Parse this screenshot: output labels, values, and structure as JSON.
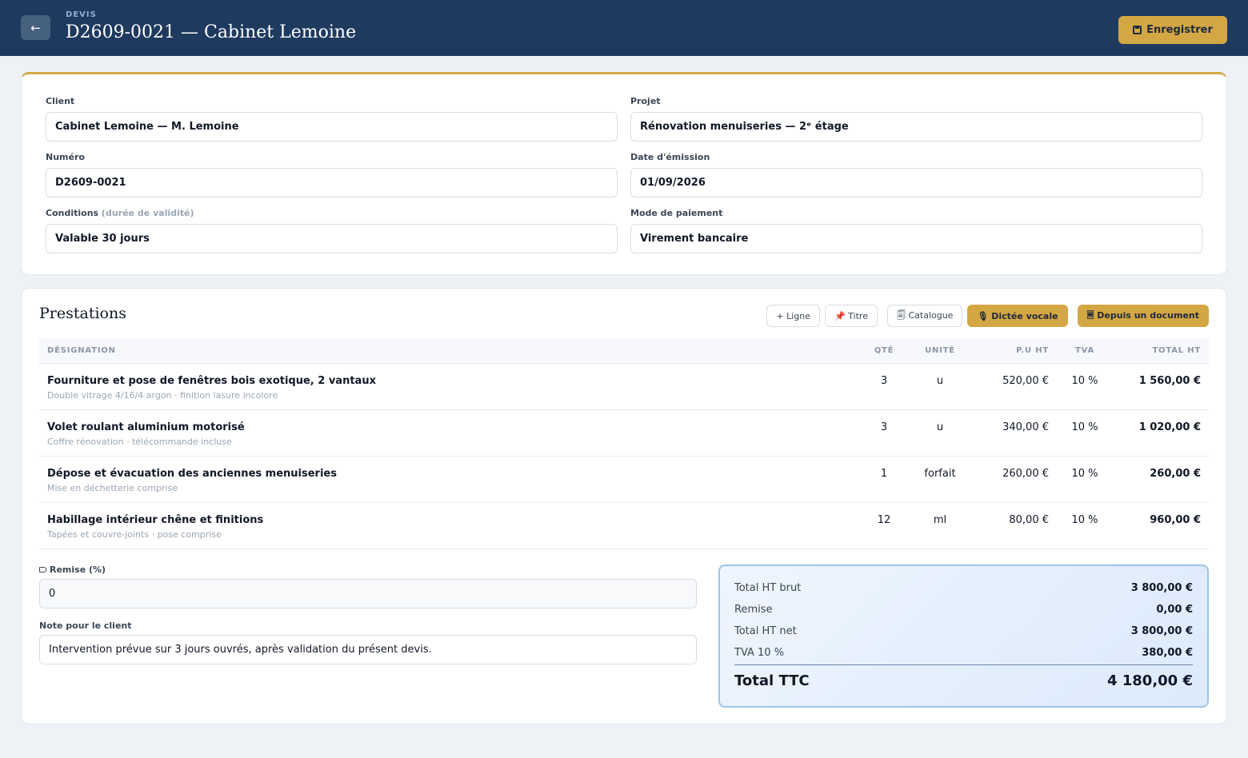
{
  "header": {
    "back_icon": "←",
    "kicker": "DEVIS",
    "title": "D2609-0021 — Cabinet Lemoine",
    "save_label": "Enregistrer",
    "save_icon": "floppy-disk"
  },
  "info": {
    "client_label": "Client",
    "client_value": "Cabinet Lemoine — M. Lemoine",
    "project_label": "Projet",
    "project_value": "Rénovation menuiseries — 2ᵉ étage",
    "number_label": "Numéro",
    "number_value": "D2609-0021",
    "date_label": "Date d'émission",
    "date_value": "01/09/2026",
    "conditions_label": "Conditions",
    "conditions_hint": "(durée de validité)",
    "conditions_value": "Valable 30 jours",
    "payment_label": "Mode de paiement",
    "payment_value": "Virement bancaire"
  },
  "items": {
    "title": "Prestations",
    "toolbar": {
      "add_line": "+ Ligne",
      "add_title": "📌 Titre",
      "catalogue": "🗐 Catalogue",
      "dictation": "🎙 Dictée vocale",
      "from_document": "🗏 Depuis un document"
    },
    "columns": {
      "designation": "DÉSIGNATION",
      "qty": "QTÉ",
      "unit": "UNITÉ",
      "unit_price": "P.U HT",
      "vat": "TVA",
      "total": "TOTAL HT"
    },
    "rows": [
      {
        "title": "Fourniture et pose de fenêtres bois exotique, 2 vantaux",
        "sub": "Double vitrage 4/16/4 argon · finition lasure incolore",
        "qty": "3",
        "unit": "u",
        "price": "520,00 €",
        "vat": "10 %",
        "total": "1 560,00 €"
      },
      {
        "title": "Volet roulant aluminium motorisé",
        "sub": "Coffre rénovation · télécommande incluse",
        "qty": "3",
        "unit": "u",
        "price": "340,00 €",
        "vat": "10 %",
        "total": "1 020,00 €"
      },
      {
        "title": "Dépose et évacuation des anciennes menuiseries",
        "sub": "Mise en déchetterie comprise",
        "qty": "1",
        "unit": "forfait",
        "price": "260,00 €",
        "vat": "10 %",
        "total": "260,00 €"
      },
      {
        "title": "Habillage intérieur chêne et finitions",
        "sub": "Tapées et couvre-joints · pose comprise",
        "qty": "12",
        "unit": "ml",
        "price": "80,00 €",
        "vat": "10 %",
        "total": "960,00 €"
      }
    ]
  },
  "discount": {
    "label": "Remise (%)",
    "value": "0"
  },
  "note": {
    "label": "Note pour le client",
    "value": "Intervention prévue sur 3 jours ouvrés, après validation du présent devis."
  },
  "totals": {
    "gross_label": "Total HT brut",
    "gross_value": "3 800,00 €",
    "discount_label": "Remise",
    "discount_value": "0,00 €",
    "net_label": "Total HT net",
    "net_value": "3 800,00 €",
    "vat_label": "TVA 10 %",
    "vat_value": "380,00 €",
    "ttc_label": "Total TTC",
    "ttc_value": "4 180,00 €"
  },
  "colors": {
    "header_bg": "#1f3a5f",
    "accent_gold": "#d4a745",
    "totals_border": "#9cc5ec"
  }
}
